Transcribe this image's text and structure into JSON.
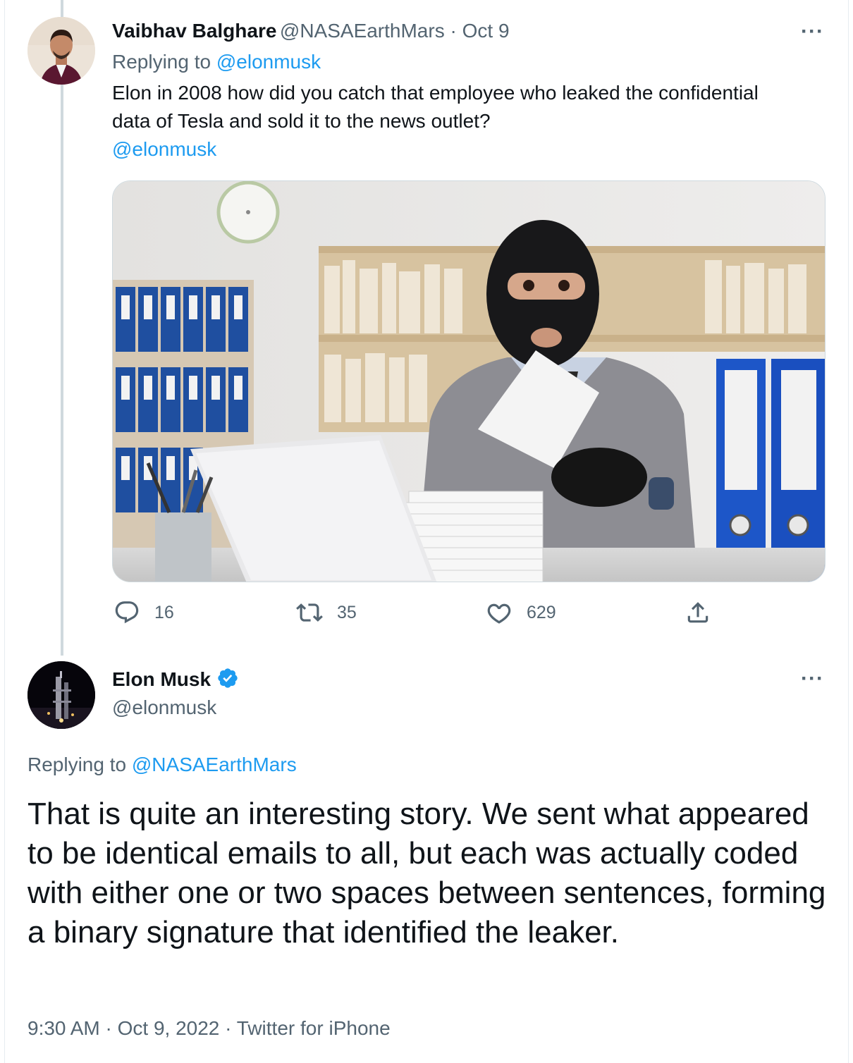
{
  "tweet1": {
    "display_name": "Vaibhav Balghare",
    "handle": "@NASAEarthMars",
    "separator": " · ",
    "date": "Oct 9",
    "replying_prefix": "Replying to ",
    "replying_to": "@elonmusk",
    "text_line1": "Elon in 2008 how did you catch that employee who leaked the confidential",
    "text_line2": "data of Tesla and sold it to the news outlet?",
    "mention": "@elonmusk",
    "reply_count": "16",
    "retweet_count": "35",
    "like_count": "629",
    "more_label": "···"
  },
  "tweet2": {
    "display_name": "Elon Musk",
    "handle": "@elonmusk",
    "verified": true,
    "more_label": "···",
    "replying_prefix": "Replying to ",
    "replying_to": "@NASAEarthMars",
    "text": "That is quite an interesting story. We sent what appeared to be identical emails to all, but each was actually coded with either one or two spaces between sentences, forming a binary signature that identified the leaker.",
    "time": "9:30 AM",
    "sep1": " · ",
    "date": "Oct 9, 2022",
    "sep2": " · ",
    "source": "Twitter for iPhone"
  },
  "icons": {
    "reply": "reply-icon",
    "retweet": "retweet-icon",
    "like": "heart-icon",
    "share": "share-icon",
    "verified": "verified-badge-icon"
  },
  "colors": {
    "link": "#1d9bf0",
    "muted": "#536471",
    "text": "#0f1419",
    "thread_line": "#cfd9de"
  }
}
